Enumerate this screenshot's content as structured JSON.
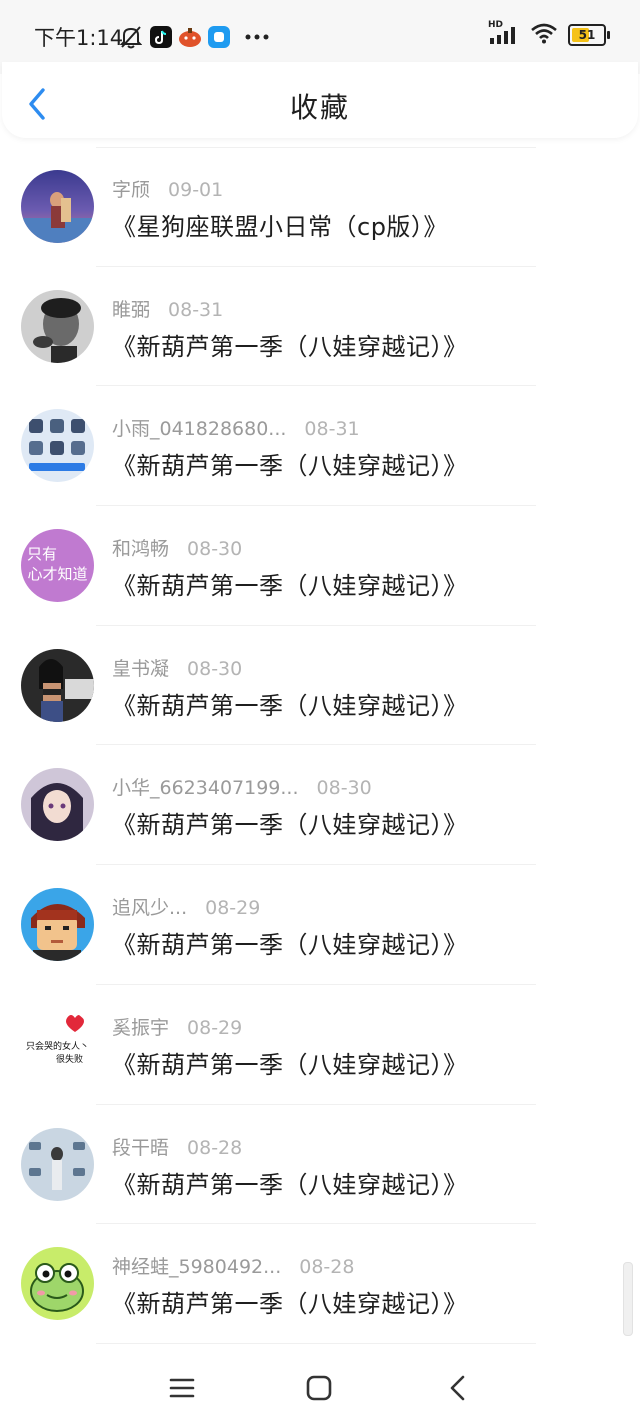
{
  "status_bar": {
    "time": "下午1:14",
    "battery": "51",
    "network_label": "HD",
    "icons": [
      "bell-muted-icon",
      "tiktok-icon",
      "pumpkin-app-icon",
      "blue-app-icon",
      "more-dots-icon",
      "signal-icon",
      "wifi-icon",
      "battery-icon"
    ]
  },
  "header": {
    "title": "收藏",
    "back_icon": "chevron-left-icon"
  },
  "colors": {
    "accent": "#2d8cf0",
    "title_text": "#1f1f1f",
    "meta_text": "#9a9a9a",
    "divider": "#f0f0f0",
    "battery_fill": "#f5c218"
  },
  "favorites": [
    {
      "author": "字颀",
      "date": "09-01",
      "title": "《星狗座联盟小日常（cp版）》"
    },
    {
      "author": "睢弼",
      "date": "08-31",
      "title": "《新葫芦第一季（八娃穿越记）》"
    },
    {
      "author": "小雨_041828680...",
      "date": "08-31",
      "title": "《新葫芦第一季（八娃穿越记）》"
    },
    {
      "author": "和鸿畅",
      "date": "08-30",
      "title": "《新葫芦第一季（八娃穿越记）》",
      "avatar_text": [
        "只有",
        "心才知道"
      ]
    },
    {
      "author": "皇书凝",
      "date": "08-30",
      "title": "《新葫芦第一季（八娃穿越记）》"
    },
    {
      "author": "小华_6623407199...",
      "date": "08-30",
      "title": "《新葫芦第一季（八娃穿越记）》"
    },
    {
      "author": "追风少...",
      "date": "08-29",
      "title": "《新葫芦第一季（八娃穿越记）》"
    },
    {
      "author": "奚振宇",
      "date": "08-29",
      "title": "《新葫芦第一季（八娃穿越记）》",
      "avatar_text": [
        "只会哭的女人丶",
        "很失败"
      ]
    },
    {
      "author": "段干晤",
      "date": "08-28",
      "title": "《新葫芦第一季（八娃穿越记）》"
    },
    {
      "author": "神经蛙_5980492...",
      "date": "08-28",
      "title": "《新葫芦第一季（八娃穿越记）》"
    }
  ],
  "nav_bar": {
    "icons": [
      "menu-icon",
      "home-square-icon",
      "back-triangle-icon"
    ]
  }
}
